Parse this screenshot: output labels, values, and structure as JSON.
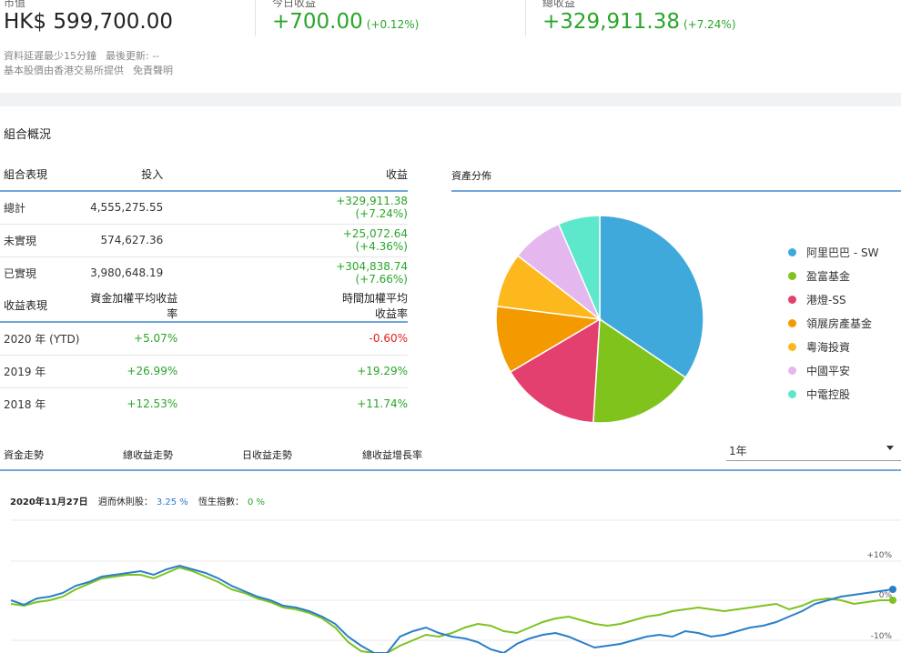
{
  "summary": {
    "market_value_label": "市值",
    "market_value": "HK$ 599,700.00",
    "today_label": "今日收益",
    "today_value": "+700.00",
    "today_pct": "(+0.12%)",
    "total_label": "總收益",
    "total_value": "+329,911.38",
    "total_pct": "(+7.24%)",
    "note_delay": "資料延遲最少15分鐘",
    "note_updated": "最後更新: --",
    "note_source": "基本股價由香港交易所提供",
    "note_disclaimer": "免責聲明"
  },
  "overview": {
    "title": "組合概況",
    "perf_header": [
      "組合表現",
      "投入",
      "收益"
    ],
    "perf_rows": [
      [
        "總計",
        "4,555,275.55",
        "+329,911.38 (+7.24%)"
      ],
      [
        "未實現",
        "574,627.36",
        "+25,072.64 (+4.36%)"
      ],
      [
        "已實現",
        "3,980,648.19",
        "+304,838.74 (+7.66%)"
      ]
    ],
    "return_header": [
      "收益表現",
      "資金加權平均收益率",
      "時間加權平均收益率"
    ],
    "return_rows": [
      [
        "2020 年 (YTD)",
        "+5.07%",
        "-0.60%"
      ],
      [
        "2019 年",
        "+26.99%",
        "+19.29%"
      ],
      [
        "2018 年",
        "+12.53%",
        "+11.74%"
      ]
    ]
  },
  "allocation": {
    "title": "資產分佈",
    "items": [
      {
        "name": "阿里巴巴 - SW",
        "color": "#3fa9dc",
        "share": 0.345
      },
      {
        "name": "盈富基金",
        "color": "#7fc31c",
        "share": 0.165
      },
      {
        "name": "港燈-SS",
        "color": "#e4406f",
        "share": 0.155
      },
      {
        "name": "領展房產基金",
        "color": "#f39a00",
        "share": 0.105
      },
      {
        "name": "粵海投資",
        "color": "#fdb81e",
        "share": 0.085
      },
      {
        "name": "中國平安",
        "color": "#e4b7ee",
        "share": 0.08
      },
      {
        "name": "中電控股",
        "color": "#5de8cb",
        "share": 0.065
      }
    ]
  },
  "trend": {
    "tabs": [
      "資金走勢",
      "總收益走勢",
      "日收益走勢",
      "總收益增長率"
    ],
    "period": "1年",
    "date": "2020年11月27日",
    "series1_label": "週而休則股：",
    "series1_value": "3.25 %",
    "series2_label": "恆生指數：",
    "series2_value": "0 %",
    "y_ticks": [
      "+10%",
      "0%",
      "-10%"
    ]
  },
  "colors": {
    "blue_line": "#2a7fc8",
    "green_line": "#7ec21f",
    "accent": "#6fa8dc"
  }
}
